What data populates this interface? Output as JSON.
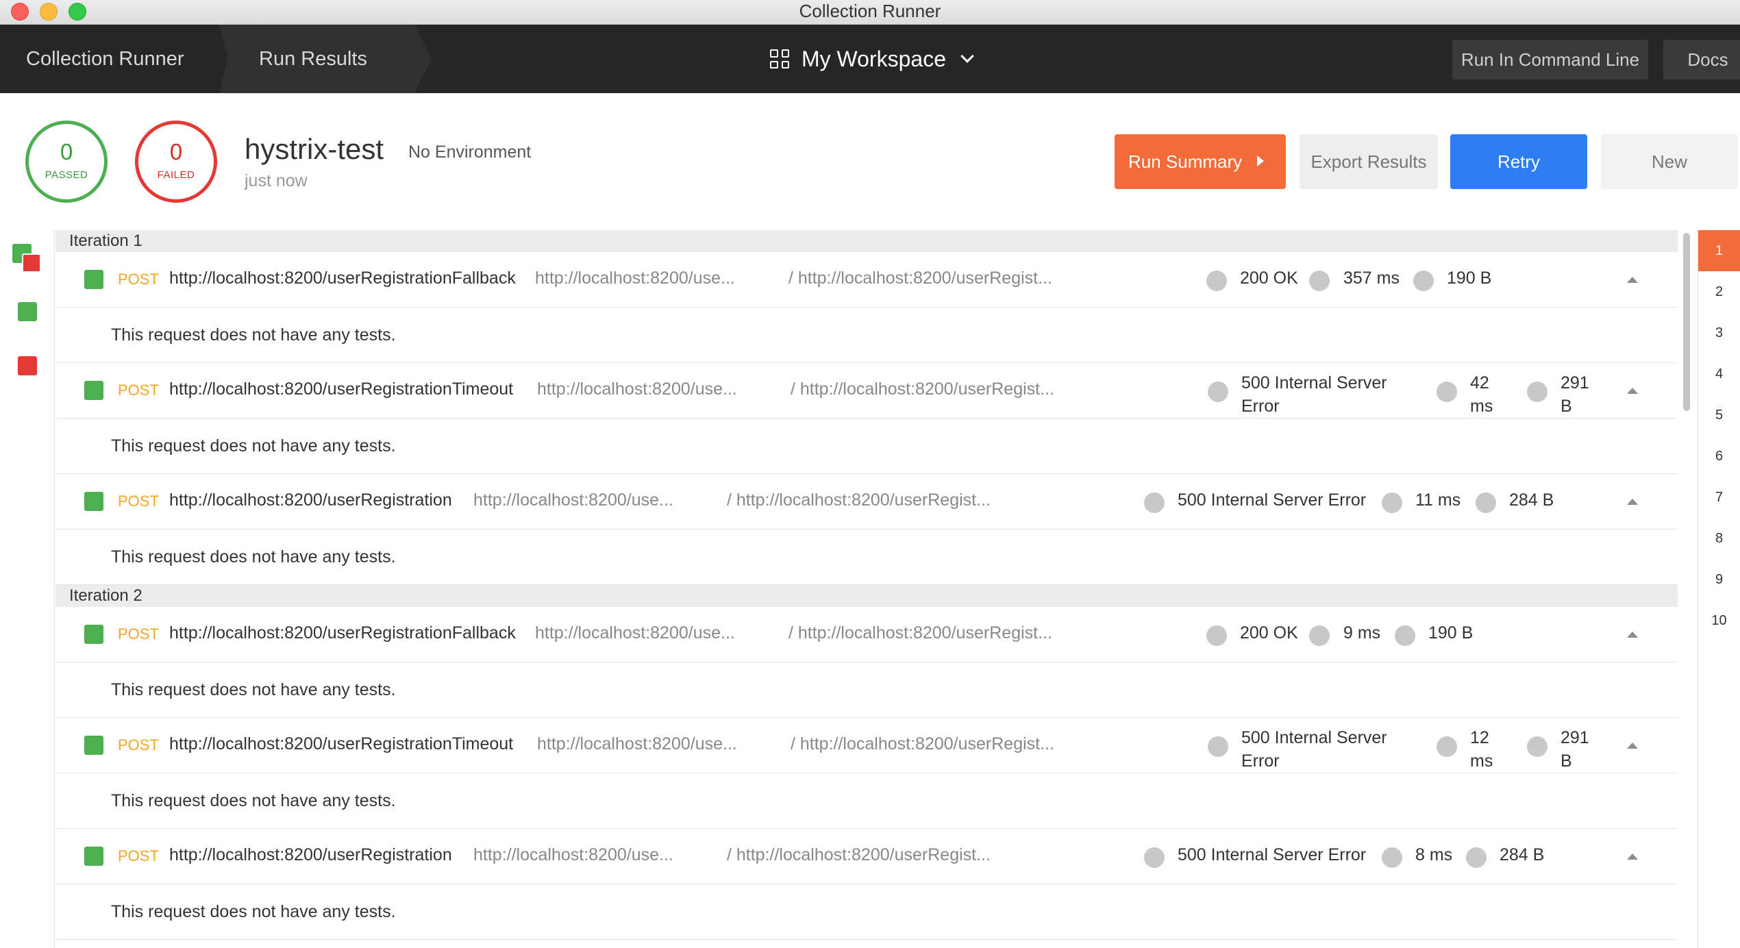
{
  "window": {
    "title": "Collection Runner"
  },
  "nav": {
    "crumb_runner": "Collection Runner",
    "crumb_results": "Run Results",
    "workspace": "My Workspace",
    "run_cli": "Run In Command Line",
    "docs": "Docs"
  },
  "summary": {
    "passed_count": "0",
    "passed_label": "PASSED",
    "failed_count": "0",
    "failed_label": "FAILED",
    "collection": "hystrix-test",
    "environment": "No Environment",
    "time": "just now",
    "run_summary": "Run Summary",
    "export": "Export Results",
    "retry": "Retry",
    "new": "New"
  },
  "iterations": [
    {
      "title": "Iteration 1",
      "requests": [
        {
          "method": "POST",
          "url": "http://localhost:8200/userRegistrationFallback",
          "eurl": "http://localhost:8200/use...",
          "path": "/ http://localhost:8200/userRegist...",
          "status": "200 OK",
          "time": "357 ms",
          "size": "190 B",
          "note": "This request does not have any tests."
        },
        {
          "method": "POST",
          "url": "http://localhost:8200/userRegistrationTimeout",
          "eurl": "http://localhost:8200/use...",
          "path": "/ http://localhost:8200/userRegist...",
          "status": "500 Internal Server Error",
          "time": "42 ms",
          "size": "291 B",
          "note": "This request does not have any tests."
        },
        {
          "method": "POST",
          "url": "http://localhost:8200/userRegistration",
          "eurl": "http://localhost:8200/use...",
          "path": "/ http://localhost:8200/userRegist...",
          "status": "500 Internal Server Error",
          "time": "11 ms",
          "size": "284 B",
          "note": "This request does not have any tests."
        }
      ]
    },
    {
      "title": "Iteration 2",
      "requests": [
        {
          "method": "POST",
          "url": "http://localhost:8200/userRegistrationFallback",
          "eurl": "http://localhost:8200/use...",
          "path": "/ http://localhost:8200/userRegist...",
          "status": "200 OK",
          "time": "9 ms",
          "size": "190 B",
          "note": "This request does not have any tests."
        },
        {
          "method": "POST",
          "url": "http://localhost:8200/userRegistrationTimeout",
          "eurl": "http://localhost:8200/use...",
          "path": "/ http://localhost:8200/userRegist...",
          "status": "500 Internal Server Error",
          "time": "12 ms",
          "size": "291 B",
          "note": "This request does not have any tests."
        },
        {
          "method": "POST",
          "url": "http://localhost:8200/userRegistration",
          "eurl": "http://localhost:8200/use...",
          "path": "/ http://localhost:8200/userRegist...",
          "status": "500 Internal Server Error",
          "time": "8 ms",
          "size": "284 B",
          "note": "This request does not have any tests."
        }
      ]
    }
  ],
  "iteration_numbers": [
    "1",
    "2",
    "3",
    "4",
    "5",
    "6",
    "7",
    "8",
    "9",
    "10"
  ],
  "colors": {
    "accent": "#f26b3a",
    "retry": "#2d7cf0",
    "pass": "#4caf50",
    "fail": "#e53935",
    "method": "#f5a623"
  }
}
